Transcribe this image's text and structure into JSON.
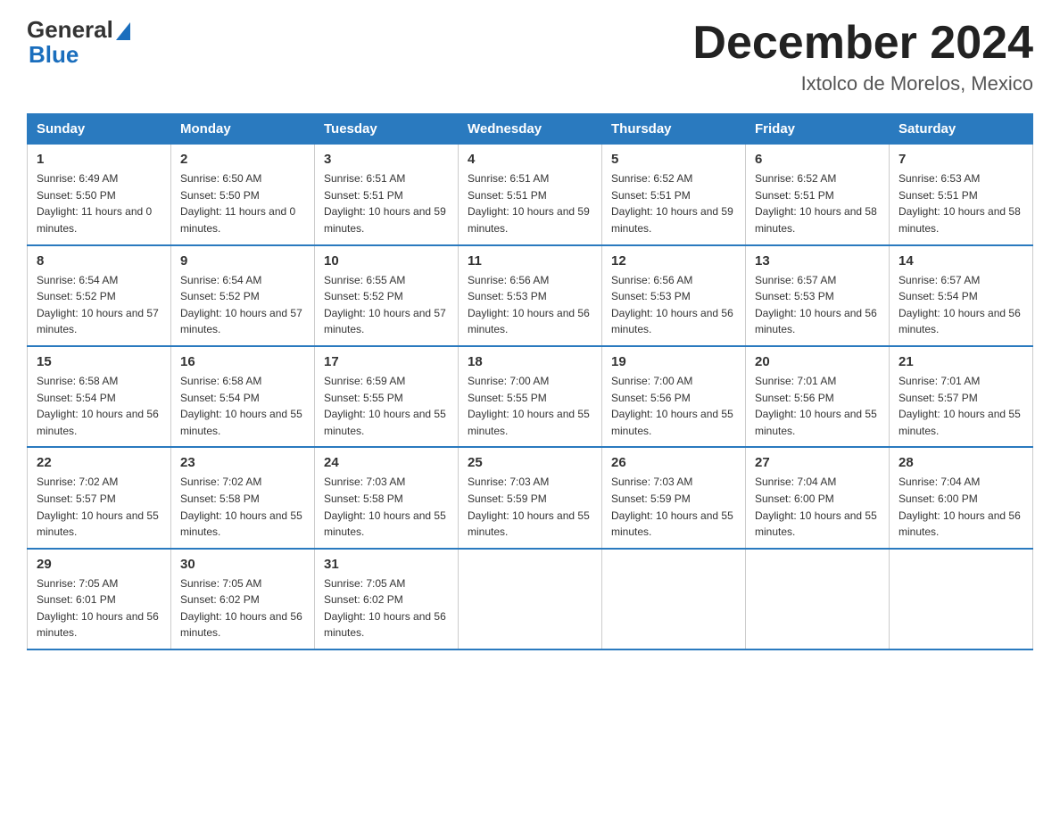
{
  "header": {
    "logo_general": "General",
    "logo_blue": "Blue",
    "month_title": "December 2024",
    "location": "Ixtolco de Morelos, Mexico"
  },
  "days_of_week": [
    "Sunday",
    "Monday",
    "Tuesday",
    "Wednesday",
    "Thursday",
    "Friday",
    "Saturday"
  ],
  "weeks": [
    [
      {
        "day": "1",
        "sunrise": "6:49 AM",
        "sunset": "5:50 PM",
        "daylight": "11 hours and 0 minutes."
      },
      {
        "day": "2",
        "sunrise": "6:50 AM",
        "sunset": "5:50 PM",
        "daylight": "11 hours and 0 minutes."
      },
      {
        "day": "3",
        "sunrise": "6:51 AM",
        "sunset": "5:51 PM",
        "daylight": "10 hours and 59 minutes."
      },
      {
        "day": "4",
        "sunrise": "6:51 AM",
        "sunset": "5:51 PM",
        "daylight": "10 hours and 59 minutes."
      },
      {
        "day": "5",
        "sunrise": "6:52 AM",
        "sunset": "5:51 PM",
        "daylight": "10 hours and 59 minutes."
      },
      {
        "day": "6",
        "sunrise": "6:52 AM",
        "sunset": "5:51 PM",
        "daylight": "10 hours and 58 minutes."
      },
      {
        "day": "7",
        "sunrise": "6:53 AM",
        "sunset": "5:51 PM",
        "daylight": "10 hours and 58 minutes."
      }
    ],
    [
      {
        "day": "8",
        "sunrise": "6:54 AM",
        "sunset": "5:52 PM",
        "daylight": "10 hours and 57 minutes."
      },
      {
        "day": "9",
        "sunrise": "6:54 AM",
        "sunset": "5:52 PM",
        "daylight": "10 hours and 57 minutes."
      },
      {
        "day": "10",
        "sunrise": "6:55 AM",
        "sunset": "5:52 PM",
        "daylight": "10 hours and 57 minutes."
      },
      {
        "day": "11",
        "sunrise": "6:56 AM",
        "sunset": "5:53 PM",
        "daylight": "10 hours and 56 minutes."
      },
      {
        "day": "12",
        "sunrise": "6:56 AM",
        "sunset": "5:53 PM",
        "daylight": "10 hours and 56 minutes."
      },
      {
        "day": "13",
        "sunrise": "6:57 AM",
        "sunset": "5:53 PM",
        "daylight": "10 hours and 56 minutes."
      },
      {
        "day": "14",
        "sunrise": "6:57 AM",
        "sunset": "5:54 PM",
        "daylight": "10 hours and 56 minutes."
      }
    ],
    [
      {
        "day": "15",
        "sunrise": "6:58 AM",
        "sunset": "5:54 PM",
        "daylight": "10 hours and 56 minutes."
      },
      {
        "day": "16",
        "sunrise": "6:58 AM",
        "sunset": "5:54 PM",
        "daylight": "10 hours and 55 minutes."
      },
      {
        "day": "17",
        "sunrise": "6:59 AM",
        "sunset": "5:55 PM",
        "daylight": "10 hours and 55 minutes."
      },
      {
        "day": "18",
        "sunrise": "7:00 AM",
        "sunset": "5:55 PM",
        "daylight": "10 hours and 55 minutes."
      },
      {
        "day": "19",
        "sunrise": "7:00 AM",
        "sunset": "5:56 PM",
        "daylight": "10 hours and 55 minutes."
      },
      {
        "day": "20",
        "sunrise": "7:01 AM",
        "sunset": "5:56 PM",
        "daylight": "10 hours and 55 minutes."
      },
      {
        "day": "21",
        "sunrise": "7:01 AM",
        "sunset": "5:57 PM",
        "daylight": "10 hours and 55 minutes."
      }
    ],
    [
      {
        "day": "22",
        "sunrise": "7:02 AM",
        "sunset": "5:57 PM",
        "daylight": "10 hours and 55 minutes."
      },
      {
        "day": "23",
        "sunrise": "7:02 AM",
        "sunset": "5:58 PM",
        "daylight": "10 hours and 55 minutes."
      },
      {
        "day": "24",
        "sunrise": "7:03 AM",
        "sunset": "5:58 PM",
        "daylight": "10 hours and 55 minutes."
      },
      {
        "day": "25",
        "sunrise": "7:03 AM",
        "sunset": "5:59 PM",
        "daylight": "10 hours and 55 minutes."
      },
      {
        "day": "26",
        "sunrise": "7:03 AM",
        "sunset": "5:59 PM",
        "daylight": "10 hours and 55 minutes."
      },
      {
        "day": "27",
        "sunrise": "7:04 AM",
        "sunset": "6:00 PM",
        "daylight": "10 hours and 55 minutes."
      },
      {
        "day": "28",
        "sunrise": "7:04 AM",
        "sunset": "6:00 PM",
        "daylight": "10 hours and 56 minutes."
      }
    ],
    [
      {
        "day": "29",
        "sunrise": "7:05 AM",
        "sunset": "6:01 PM",
        "daylight": "10 hours and 56 minutes."
      },
      {
        "day": "30",
        "sunrise": "7:05 AM",
        "sunset": "6:02 PM",
        "daylight": "10 hours and 56 minutes."
      },
      {
        "day": "31",
        "sunrise": "7:05 AM",
        "sunset": "6:02 PM",
        "daylight": "10 hours and 56 minutes."
      },
      null,
      null,
      null,
      null
    ]
  ]
}
